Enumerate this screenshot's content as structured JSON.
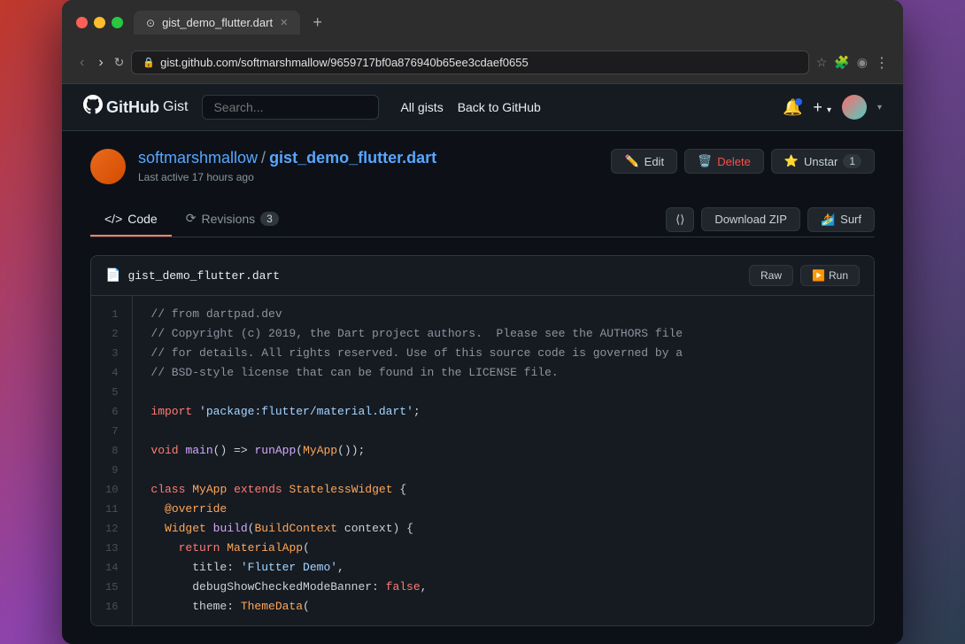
{
  "browser": {
    "traffic_lights": [
      "red",
      "yellow",
      "green"
    ],
    "tab": {
      "icon": "⊙",
      "title": "gist_demo_flutter.dart",
      "close": "✕"
    },
    "new_tab": "+",
    "nav": {
      "back": "‹",
      "forward": "›",
      "reload": "↻"
    },
    "url": "gist.github.com/softmarshmallow/9659717bf0a876940b65ee3cdaef0655",
    "url_actions": {
      "bookmark": "☆",
      "puzzle": "🧩",
      "profile": "◉",
      "menu": "⋮"
    }
  },
  "github_header": {
    "logo": "GitHub",
    "logo_gist": "Gist",
    "search_placeholder": "Search...",
    "nav_links": [
      "All gists",
      "Back to GitHub"
    ],
    "notification_icon": "🔔",
    "plus_icon": "+",
    "avatar_label": "User avatar"
  },
  "gist": {
    "author": "softmarshmallow",
    "slash": "/",
    "filename": "gist_demo_flutter.dart",
    "last_active": "Last active 17 hours ago",
    "actions": {
      "edit_label": "Edit",
      "delete_label": "Delete",
      "unstar_label": "Unstar",
      "star_count": "1"
    },
    "tabs": {
      "code_label": "Code",
      "revisions_label": "Revisions",
      "revisions_count": "3"
    },
    "tab_buttons": {
      "embed_icon": "⟨⟩",
      "download_label": "Download ZIP",
      "surf_label": "Surf"
    },
    "code_block": {
      "filename": "gist_demo_flutter.dart",
      "raw_label": "Raw",
      "run_label": "Run",
      "lines": [
        {
          "num": "1",
          "text": "// from dartpad.dev",
          "class": "c-comment"
        },
        {
          "num": "2",
          "text": "// Copyright (c) 2019, the Dart project authors.  Please see the AUTHORS file",
          "class": "c-comment"
        },
        {
          "num": "3",
          "text": "// for details. All rights reserved. Use of this source code is governed by a",
          "class": "c-comment"
        },
        {
          "num": "4",
          "text": "// BSD-style license that can be found in the LICENSE file.",
          "class": "c-comment"
        },
        {
          "num": "5",
          "text": "",
          "class": ""
        },
        {
          "num": "6",
          "text": "",
          "class": "mixed-import"
        },
        {
          "num": "7",
          "text": "",
          "class": ""
        },
        {
          "num": "8",
          "text": "",
          "class": "mixed-main"
        },
        {
          "num": "9",
          "text": "",
          "class": ""
        },
        {
          "num": "10",
          "text": "",
          "class": "mixed-class"
        },
        {
          "num": "11",
          "text": "",
          "class": "mixed-override"
        },
        {
          "num": "12",
          "text": "",
          "class": "mixed-widget"
        },
        {
          "num": "13",
          "text": "",
          "class": "mixed-return"
        },
        {
          "num": "14",
          "text": "",
          "class": "mixed-title"
        },
        {
          "num": "15",
          "text": "",
          "class": "mixed-debug"
        },
        {
          "num": "16",
          "text": "",
          "class": "mixed-theme"
        }
      ]
    }
  }
}
